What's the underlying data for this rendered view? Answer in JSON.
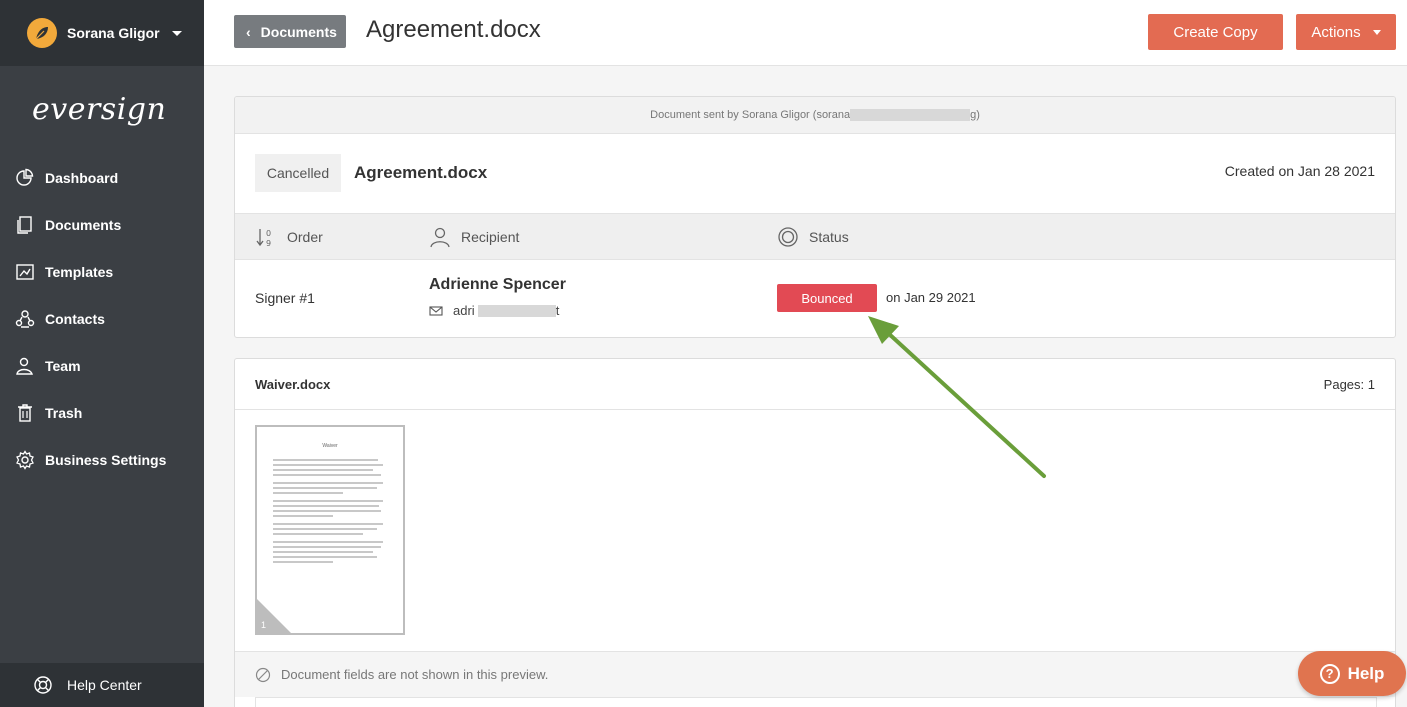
{
  "user": {
    "name": "Sorana Gligor"
  },
  "logo": "eversign",
  "nav": {
    "items": [
      {
        "label": "Dashboard",
        "icon": "pie-chart-icon"
      },
      {
        "label": "Documents",
        "icon": "documents-icon"
      },
      {
        "label": "Templates",
        "icon": "templates-icon"
      },
      {
        "label": "Contacts",
        "icon": "contacts-icon"
      },
      {
        "label": "Team",
        "icon": "team-icon"
      },
      {
        "label": "Trash",
        "icon": "trash-icon"
      },
      {
        "label": "Business Settings",
        "icon": "gear-icon"
      }
    ],
    "help_center": "Help Center"
  },
  "topbar": {
    "back_label": "Documents",
    "title": "Agreement.docx",
    "create_copy": "Create Copy",
    "actions": "Actions"
  },
  "document": {
    "sent_by_prefix": "Document sent by Sorana Gligor (sorana",
    "sent_by_suffix": "g)",
    "status_badge": "Cancelled",
    "title": "Agreement.docx",
    "created": "Created on Jan 28 2021",
    "columns": {
      "order": "Order",
      "recipient": "Recipient",
      "status": "Status"
    },
    "signers": [
      {
        "order": "Signer #1",
        "name": "Adrienne Spencer",
        "email_prefix": "adri",
        "email_suffix": "t",
        "status": "Bounced",
        "status_date": "on Jan 29 2021"
      }
    ]
  },
  "file": {
    "name": "Waiver.docx",
    "pages": "Pages: 1",
    "thumb_title": "Waiver",
    "thumb_page": "1",
    "fields_note": "Document fields are not shown in this preview."
  },
  "help_button": "Help",
  "colors": {
    "accent": "#e36b52",
    "bounced": "#e24a54",
    "sidebar": "#3b3f44",
    "annotation_arrow": "#6a9e3a"
  }
}
